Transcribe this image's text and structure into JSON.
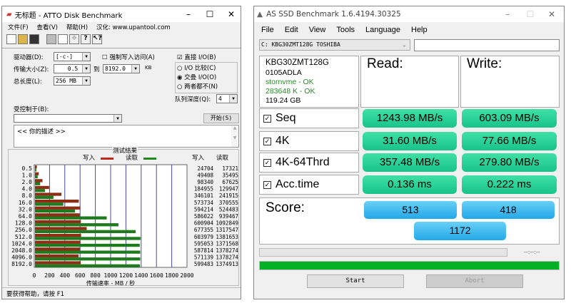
{
  "atto": {
    "title": "无标题 - ATTO Disk Benchmark",
    "menu": [
      "文件(F)",
      "查看(V)",
      "帮助(H)",
      "汉化: www.upantool.com"
    ],
    "drive_label": "驱动器(D):",
    "drive_value": "[-c-]",
    "force_write_label": "强制写入访问(A)",
    "direct_io_label": "直接 I/O(B)",
    "transfer_label": "传输大小(Z):",
    "transfer_from": "0.5",
    "to_label": "到",
    "transfer_to": "8192.0",
    "kb_label": "KB",
    "total_label": "总长度(L):",
    "total_value": "256 MB",
    "radio": [
      "I/O 比较(C)",
      "交叠 I/O(O)",
      "两者都不(N)"
    ],
    "queue_label": "队列深度(Q):",
    "queue_value": "4",
    "controlled_label": "受控制于(B):",
    "start_button": "开始(S)",
    "description": "<<  你的描述  >>",
    "results_title": "测试结果",
    "status": "要获得帮助，请按 F1"
  },
  "chart_data": {
    "type": "bar",
    "title": "测试结果",
    "legend": [
      {
        "name": "写入",
        "color": "#c0281e"
      },
      {
        "name": "读取",
        "color": "#1e8a1e"
      }
    ],
    "categories": [
      "0.5",
      "1.0",
      "2.0",
      "4.0",
      "8.0",
      "16.0",
      "32.0",
      "64.0",
      "128.0",
      "256.0",
      "512.0",
      "1024.0",
      "2048.0",
      "4096.0",
      "8192.0"
    ],
    "series": [
      {
        "name": "写入",
        "values": [
          24704,
          49408,
          98340,
          184955,
          346101,
          573734,
          594214,
          586022,
          600904,
          677355,
          603979,
          595053,
          587814,
          571139,
          599483
        ]
      },
      {
        "name": "读取",
        "values": [
          17321,
          35495,
          67625,
          129947,
          241915,
          370555,
          524483,
          939467,
          1092849,
          1317547,
          1381653,
          1371568,
          1378274,
          1378274,
          1374913
        ]
      }
    ],
    "column_headers": [
      "写入",
      "读取"
    ],
    "xlabel": "传输速率 - MB / 秒",
    "xticks": [
      "0",
      "200",
      "400",
      "600",
      "800",
      "1000",
      "1200",
      "1400",
      "1600",
      "1800",
      "2000"
    ],
    "xlim": [
      0,
      2000
    ]
  },
  "asssd": {
    "title": "AS SSD Benchmark 1.6.4194.30325",
    "menu": [
      "File",
      "Edit",
      "View",
      "Tools",
      "Language",
      "Help"
    ],
    "drive": "C: KBG30ZMT128G TOSHIBA",
    "info": [
      "KBG30ZMT128G",
      "0105ADLA",
      "stornvme - OK",
      "283648 K - OK",
      "119.24 GB"
    ],
    "read_header": "Read:",
    "write_header": "Write:",
    "rows": [
      {
        "label": "Seq",
        "read": "1243.98 MB/s",
        "write": "603.09 MB/s"
      },
      {
        "label": "4K",
        "read": "31.60 MB/s",
        "write": "77.66 MB/s"
      },
      {
        "label": "4K-64Thrd",
        "read": "357.48 MB/s",
        "write": "279.80 MB/s"
      },
      {
        "label": "Acc.time",
        "read": "0.136 ms",
        "write": "0.222 ms"
      }
    ],
    "score_label": "Score:",
    "score_read": "513",
    "score_write": "418",
    "score_total": "1172",
    "time": "--:--:--",
    "progress": 1.0,
    "start": "Start",
    "abort": "Abort",
    "check": "☑"
  }
}
